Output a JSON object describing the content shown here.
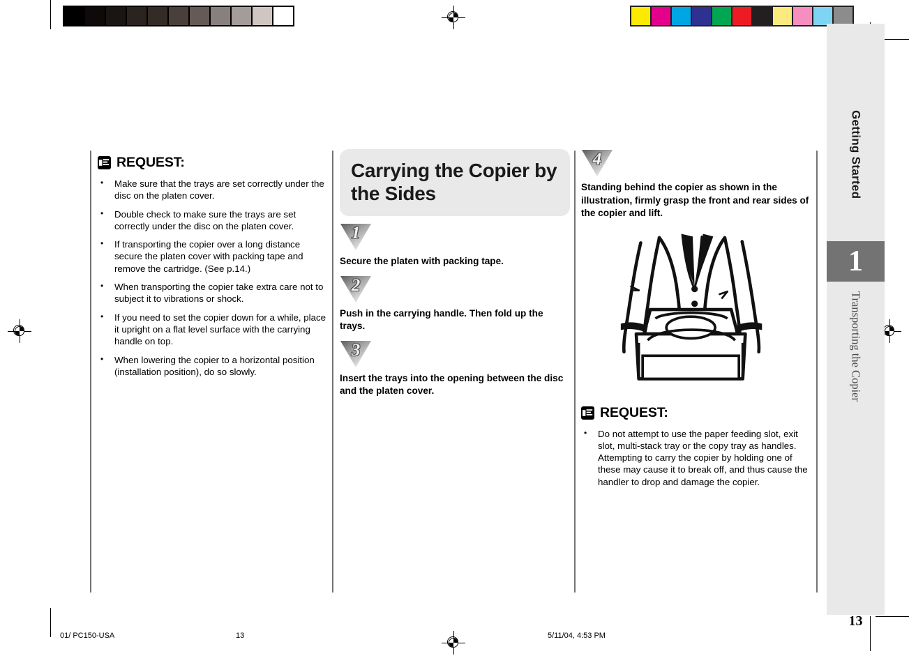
{
  "document": {
    "page_number": "13",
    "chapter_number": "1",
    "chapter_name": "Getting Started",
    "section_name": "Transporting the Copier"
  },
  "calibration": {
    "grayscale_patches": [
      "#000000",
      "#0d0a09",
      "#1a1513",
      "#2b2320",
      "#342b27",
      "#4a3f3a",
      "#655a55",
      "#87807c",
      "#a49c99",
      "#cfc6c2",
      "#ffffff"
    ],
    "color_patches": [
      "#fcea00",
      "#e5008c",
      "#00a5e3",
      "#2e3192",
      "#00a651",
      "#ed1c24",
      "#231f20",
      "#fbea7e",
      "#f68fc0",
      "#7fd4f4",
      "#8c8c8c"
    ]
  },
  "left_column": {
    "request": {
      "icon": "pointing-hand-icon",
      "title": "REQUEST:",
      "items": [
        "Make sure that the trays are set correctly under the disc on the platen cover.",
        "Double check to make sure the trays are set correctly under the disc on the platen cover.",
        "If transporting the copier over a long distance secure the platen cover with packing tape and remove the cartridge. (See p.14.)",
        "When transporting the copier take extra care not to subject it to vibrations or shock.",
        "If you need to set the copier down for a while, place it upright on a flat level surface with the carrying handle on top.",
        "When lowering the copier to a horizontal position (installation position), do so slowly."
      ]
    }
  },
  "middle_column": {
    "section_title": "Carrying the Copier by the Sides",
    "steps": [
      {
        "number": "1",
        "text": "Secure the platen with packing tape."
      },
      {
        "number": "2",
        "text": "Push in the carrying handle. Then fold up the trays."
      },
      {
        "number": "3",
        "text": "Insert the trays into the opening between the disc and the platen cover."
      }
    ]
  },
  "right_column": {
    "steps": [
      {
        "number": "4",
        "text": "Standing behind the copier as shown in the illustration, firmly grasp the front and rear sides of the copier and lift."
      }
    ],
    "illustration": "person-carrying-copier-illustration",
    "request": {
      "icon": "pointing-hand-icon",
      "title": "REQUEST:",
      "items": [
        "Do not attempt to use the paper feeding slot, exit slot, multi-stack tray or the copy tray as handles. Attempting to carry the copier by holding one of these may cause it to break off, and thus cause the handler to drop and damage the copier."
      ]
    }
  },
  "footer": {
    "file_label": "01/ PC150-USA",
    "page_label": "13",
    "date_label": "5/11/04, 4:53 PM"
  },
  "colors": {
    "tab_background": "#e9e9e9",
    "tab_number_background": "#737373",
    "title_box_background": "#e9e9e9",
    "rule": "#737373"
  }
}
